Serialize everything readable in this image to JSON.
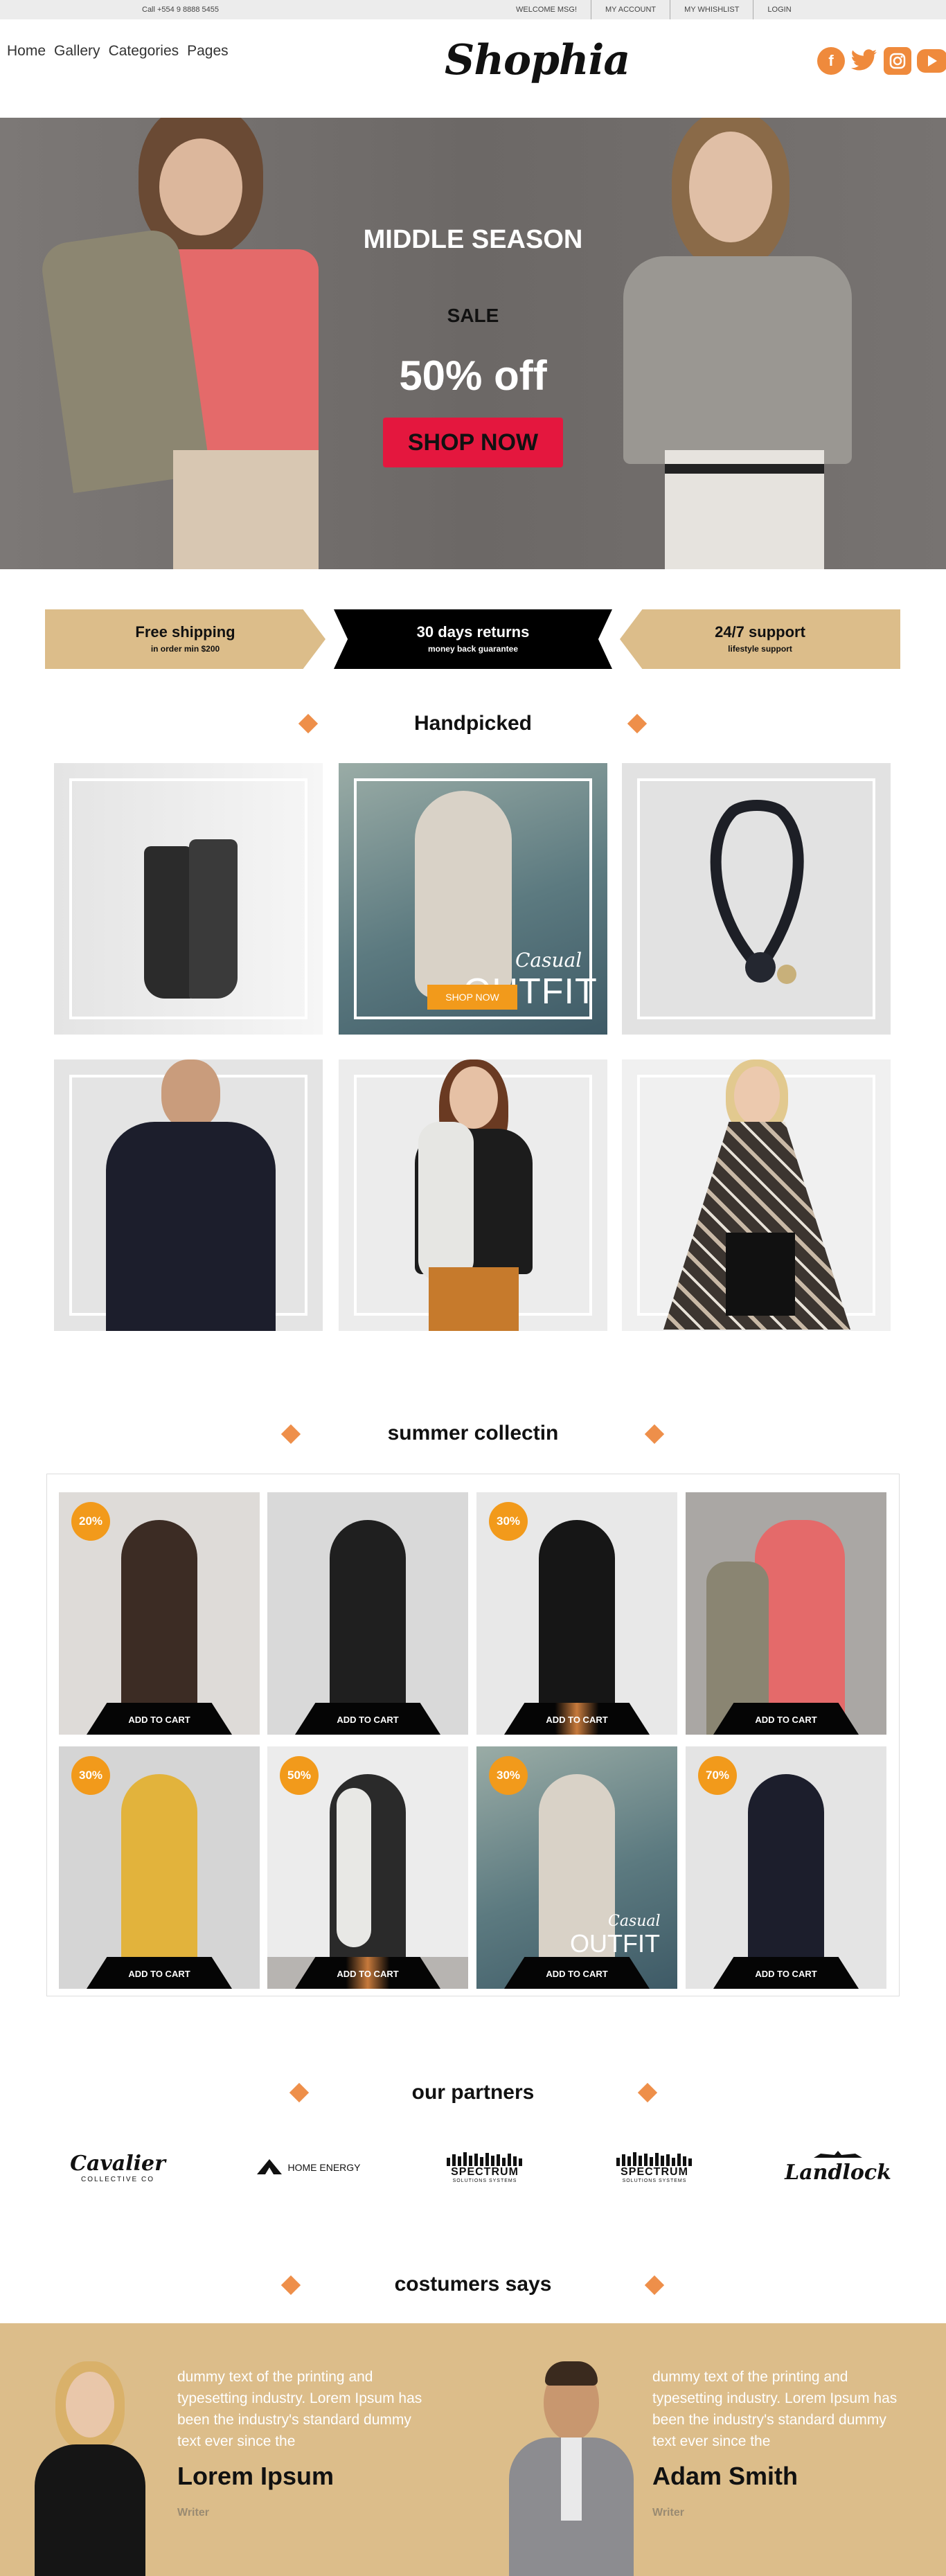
{
  "topbar": {
    "call": "Call +554 9 8888 5455",
    "links": [
      "WELCOME MSG!",
      "MY ACCOUNT",
      "MY WHISHLIST",
      "LOGIN"
    ]
  },
  "nav": [
    "Home",
    "Gallery",
    "Categories",
    "Pages"
  ],
  "logo": "Shophia",
  "social_icons": [
    "facebook-icon",
    "twitter-icon",
    "instagram-icon",
    "youtube-icon"
  ],
  "social_icon_color": "#ef8a3c",
  "hero": {
    "title": "MIDDLE SEASON",
    "sale": "SALE",
    "discount": "50% off",
    "cta": "SHOP NOW",
    "cta_color": "#e4173e"
  },
  "banners": [
    {
      "title": "Free shipping",
      "subtitle": "in order min $200"
    },
    {
      "title": "30 days returns",
      "subtitle": "money back guarantee"
    },
    {
      "title": "24/7 support",
      "subtitle": "lifestyle support"
    }
  ],
  "banner_color": "#dcbd8a",
  "handpicked": {
    "title": "Handpicked",
    "overlay_script": "Casual",
    "overlay_word": "OUTFIT",
    "overlay_button": "SHOP NOW"
  },
  "summer": {
    "title": "summer collectin",
    "cart_label": "ADD TO CART",
    "badges": [
      "20%",
      "",
      "30%",
      "",
      "30%",
      "50%",
      "30%",
      "70%"
    ],
    "card_overlay_script": "Casual",
    "card_overlay_word": "OUTFIT"
  },
  "partners": {
    "title": "our partners",
    "logos": [
      {
        "name": "Cavalier",
        "sub": "COLLECTIVE CO"
      },
      {
        "name": "HOME ENERGY",
        "sub": ""
      },
      {
        "name": "SPECTRUM",
        "sub": "SOLUTIONS SYSTEMS"
      },
      {
        "name": "SPECTRUM",
        "sub": "SOLUTIONS SYSTEMS"
      },
      {
        "name": "Landlock",
        "sub": ""
      }
    ]
  },
  "testimonials": {
    "title": "costumers says",
    "items": [
      {
        "quote": "dummy text of the printing and typesetting industry. Lorem Ipsum has been the industry's standard dummy text ever since the",
        "name": "Lorem Ipsum",
        "role": "Writer"
      },
      {
        "quote": "dummy text of the printing and typesetting industry. Lorem Ipsum has been the industry's standard dummy text ever since the",
        "name": "Adam Smith",
        "role": "Writer"
      }
    ]
  },
  "accent_color": "#ee8f4a"
}
